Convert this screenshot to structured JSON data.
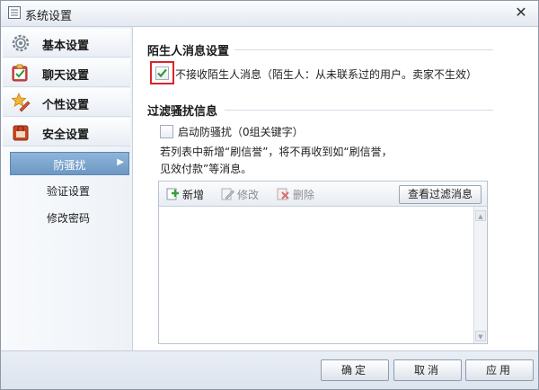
{
  "window": {
    "title": "系统设置"
  },
  "sidebar": {
    "categories": [
      {
        "label": "基本设置",
        "icon": "gear-icon"
      },
      {
        "label": "聊天设置",
        "icon": "chat-checklist-icon"
      },
      {
        "label": "个性设置",
        "icon": "star-pen-icon"
      },
      {
        "label": "安全设置",
        "icon": "shield-lock-icon"
      }
    ],
    "sub_items": [
      {
        "label": "防骚扰",
        "active": true
      },
      {
        "label": "验证设置",
        "active": false
      },
      {
        "label": "修改密码",
        "active": false
      }
    ]
  },
  "stranger": {
    "title": "陌生人消息设置",
    "checkbox_label": "不接收陌生人消息（陌生人：从未联系过的用户。卖家不生效）",
    "checked": true
  },
  "filter": {
    "title": "过滤骚扰信息",
    "enable_label": "启动防骚扰（0组关键字）",
    "enabled": false,
    "description_line1": "若列表中新增“刷信誉”，将不再收到如“刷信誉，",
    "description_line2": "见效付款”等消息。",
    "toolbar": {
      "add": "新增",
      "edit": "修改",
      "delete": "删除",
      "view_filtered": "查看过滤消息"
    }
  },
  "footer": {
    "ok": "确定",
    "cancel": "取消",
    "apply": "应用"
  },
  "colors": {
    "accent": "#6d98c4",
    "highlight_border": "#d9252a",
    "check_green": "#2e9a34"
  }
}
